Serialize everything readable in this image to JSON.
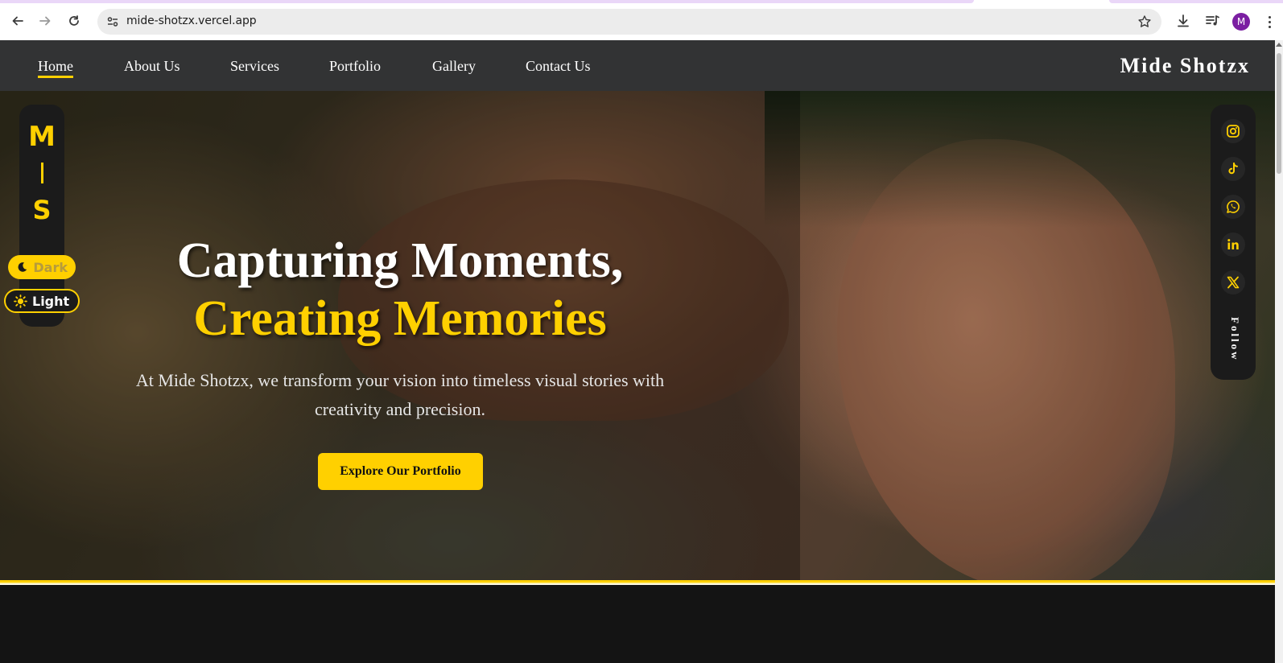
{
  "browser": {
    "url": "mide-shotzx.vercel.app",
    "profile_initial": "M"
  },
  "nav": {
    "links": [
      "Home",
      "About Us",
      "Services",
      "Portfolio",
      "Gallery",
      "Contact Us"
    ],
    "active": "Home",
    "brand": "Mide Shotzx"
  },
  "sidebar": {
    "logo_top": "M",
    "logo_bottom": "S",
    "dark_label": "Dark",
    "light_label": "Light"
  },
  "hero": {
    "headline_line1": "Capturing Moments,",
    "headline_line2": "Creating Memories",
    "tagline": "At Mide Shotzx, we transform your vision into timeless visual stories with creativity and precision.",
    "cta_label": "Explore Our Portfolio"
  },
  "social": {
    "icons": [
      "instagram-icon",
      "tiktok-icon",
      "whatsapp-icon",
      "linkedin-icon",
      "x-icon"
    ],
    "follow_label": "Follow"
  },
  "colors": {
    "accent": "#ffd000",
    "navbar": "#323334",
    "page_bg": "#141414"
  }
}
